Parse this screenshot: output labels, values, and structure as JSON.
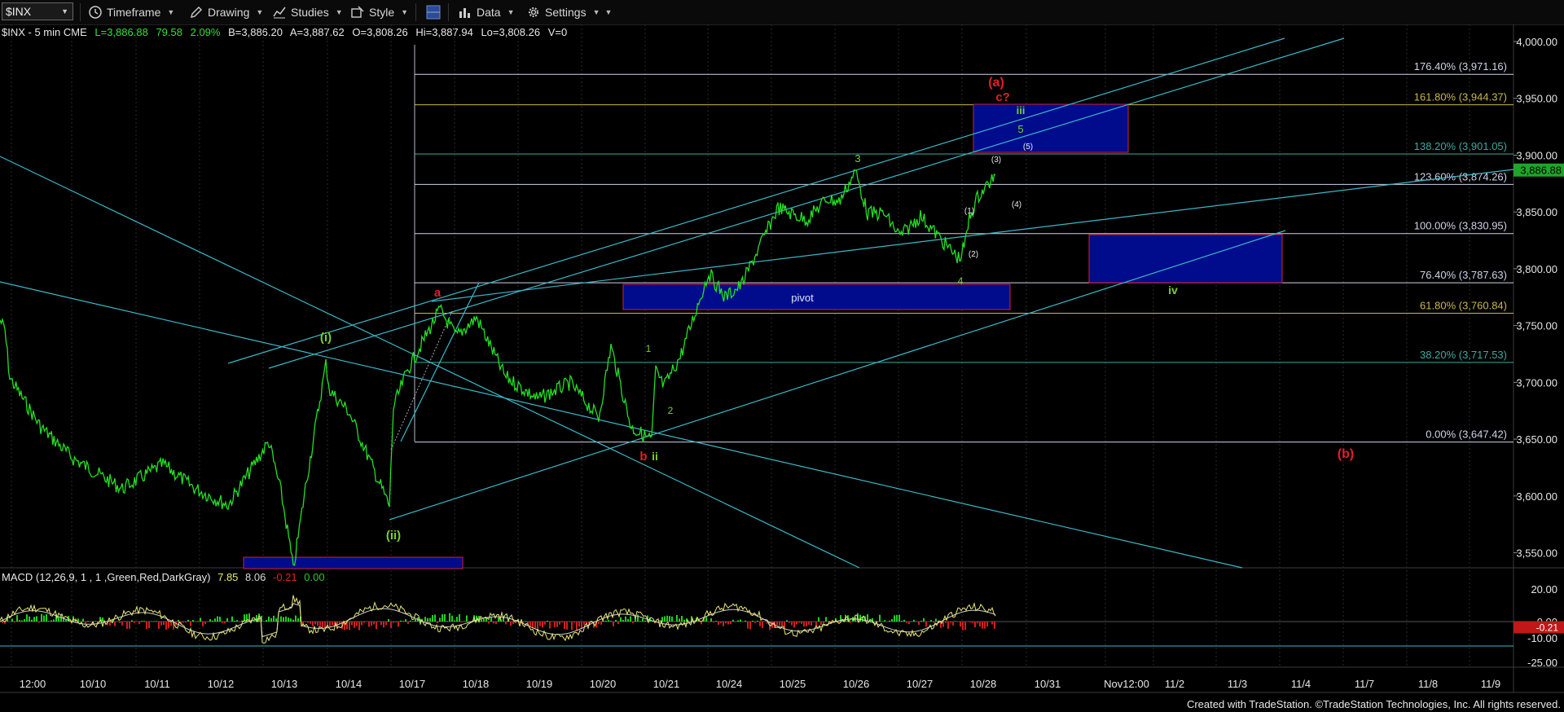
{
  "toolbar": {
    "symbol": "$INX",
    "timeframe_label": "Timeframe",
    "drawing_label": "Drawing",
    "studies_label": "Studies",
    "style_label": "Style",
    "data_label": "Data",
    "settings_label": "Settings"
  },
  "info": {
    "title": "$INX - 5 min  CME",
    "last": "L=3,886.88",
    "change": "79.58",
    "pct": "2.09%",
    "bid": "B=3,886.20",
    "ask": "A=3,887.62",
    "open": "O=3,808.26",
    "high": "Hi=3,887.94",
    "low": "Lo=3,808.26",
    "volume": "V=0"
  },
  "macd": {
    "title": "MACD (12,26,9, 1 , 1 ,Green,Red,DarkGray)",
    "macd_value": "7.85",
    "signal_value": "8.06",
    "hist_value": "-0.21",
    "zero_value": "0.00",
    "axis_labels": [
      "20.00",
      "0.00",
      "-10.00",
      "-25.00"
    ],
    "current_tag": "-0.21"
  },
  "price_axis": {
    "labels": [
      "4,000.00",
      "3,950.00",
      "3,900.00",
      "3,850.00",
      "3,800.00",
      "3,750.00",
      "3,700.00",
      "3,650.00",
      "3,600.00",
      "3,550.00"
    ],
    "current_tag": "3,886.88"
  },
  "time_axis": {
    "labels": [
      "12:00",
      "10/10",
      "10/11",
      "10/12",
      "10/13",
      "10/14",
      "10/17",
      "10/18",
      "10/19",
      "10/20",
      "10/21",
      "10/24",
      "10/25",
      "10/26",
      "10/27",
      "10/28",
      "10/31",
      "Nov12:00",
      "11/2",
      "11/3",
      "11/4",
      "11/7",
      "11/8",
      "11/9"
    ]
  },
  "fib_levels": [
    {
      "label": "176.40% (3,971.16)",
      "value": 3971.16,
      "color": "#cfd2e8"
    },
    {
      "label": "161.80% (3,944.37)",
      "value": 3944.37,
      "color": "#c8b84a"
    },
    {
      "label": "138.20% (3,901.05)",
      "value": 3901.05,
      "color": "#3fa9a0"
    },
    {
      "label": "123.60% (3,874.26)",
      "value": 3874.26,
      "color": "#cfd2e8"
    },
    {
      "label": "100.00% (3,830.95)",
      "value": 3830.95,
      "color": "#cfd2e8"
    },
    {
      "label": "76.40% (3,787.63)",
      "value": 3787.63,
      "color": "#cfd2e8"
    },
    {
      "label": "61.80% (3,760.84)",
      "value": 3760.84,
      "color": "#c8b84a"
    },
    {
      "label": "38.20% (3,717.53)",
      "value": 3717.53,
      "color": "#3fa9a0"
    },
    {
      "label": "0.00% (3,647.42)",
      "value": 3647.42,
      "color": "#cfd2e8"
    }
  ],
  "annotations": {
    "pivot": "pivot",
    "wave_a_paren": "(a)",
    "wave_c_q": "c?",
    "wave_b_paren": "(b)",
    "wave_a": "a",
    "wave_b": "b",
    "wave_ii": "ii",
    "wave_iii": "iii",
    "wave_iv": "iv",
    "wave_paren_i": "(i)",
    "wave_paren_ii": "(ii)",
    "n1": "1",
    "n2": "2",
    "n3": "3",
    "n4": "4",
    "n5": "5",
    "p1": "(1)",
    "p2": "(2)",
    "p3": "(3)",
    "p4": "(4)",
    "p5": "(5)"
  },
  "colors": {
    "price": "#22e022",
    "channel": "#3ab8c8",
    "wave_red": "#e0202a",
    "wave_green": "#7acf2a",
    "box_fill": "#000c8c",
    "box_border": "#d02040"
  },
  "footer": "Created with TradeStation. ©TradeStation Technologies, Inc. All rights reserved."
}
